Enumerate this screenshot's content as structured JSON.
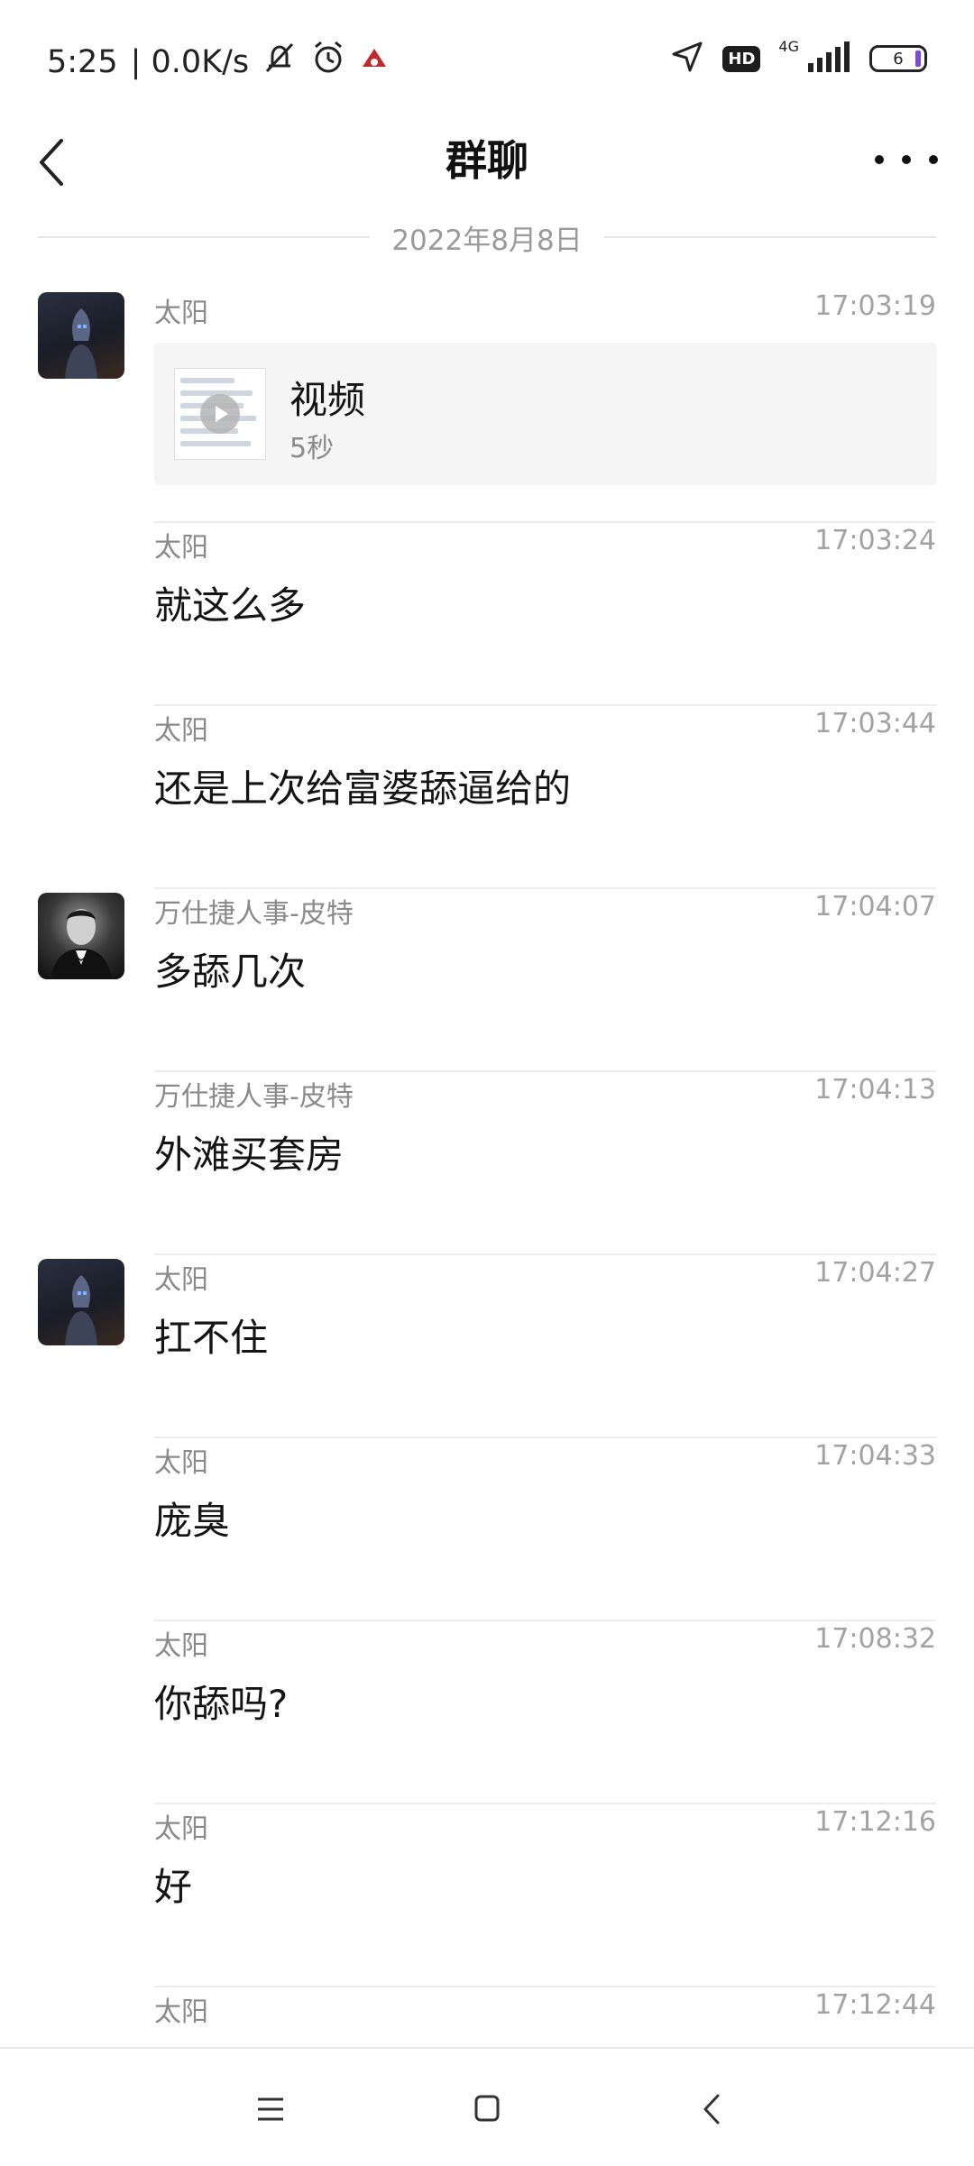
{
  "status_bar": {
    "time": "5:25",
    "speed": "| 0.0K/s",
    "network": "4G",
    "hd": "HD",
    "battery": "6"
  },
  "header": {
    "title": "群聊"
  },
  "date_divider": "2022年8月8日",
  "messages": [
    {
      "sender": "太阳",
      "time": "17:03:19",
      "type": "video",
      "video_title": "视频",
      "duration": "5秒",
      "avatar": "sun"
    },
    {
      "sender": "太阳",
      "time": "17:03:24",
      "text": "就这么多"
    },
    {
      "sender": "太阳",
      "time": "17:03:44",
      "text": "还是上次给富婆舔逼给的"
    },
    {
      "sender": "万仕捷人事-皮特",
      "time": "17:04:07",
      "text": "多舔几次",
      "avatar": "peter"
    },
    {
      "sender": "万仕捷人事-皮特",
      "time": "17:04:13",
      "text": "外滩买套房"
    },
    {
      "sender": "太阳",
      "time": "17:04:27",
      "text": "扛不住",
      "avatar": "sun"
    },
    {
      "sender": "太阳",
      "time": "17:04:33",
      "text": "庞臭"
    },
    {
      "sender": "太阳",
      "time": "17:08:32",
      "text": "你舔吗?"
    },
    {
      "sender": "太阳",
      "time": "17:12:16",
      "text": "好"
    },
    {
      "sender": "太阳",
      "time": "17:12:44",
      "text": ""
    }
  ],
  "icons": {
    "back": "chevron-left-icon",
    "more": "more-icon",
    "nav_menu": "menu-icon",
    "nav_home": "home-icon",
    "nav_back": "back-icon"
  },
  "colors": {
    "background": "#ffffff",
    "meta_text": "#8a8a8a",
    "divider": "#ececec"
  }
}
